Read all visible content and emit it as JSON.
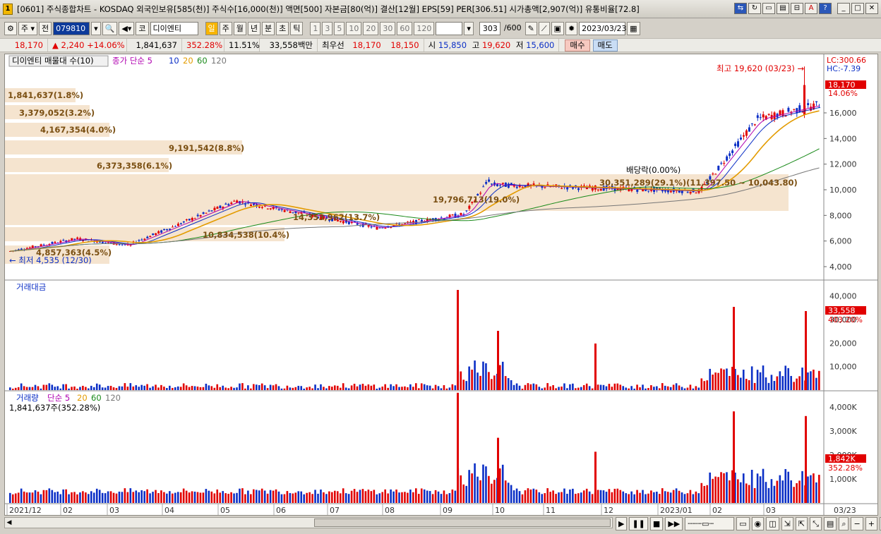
{
  "window": {
    "icon": "chart-app-icon",
    "title": "[0601] 주식종합차트 - KOSDAQ 외국인보유[585(천)] 주식수[16,000(천)] 액면[500] 자본금[80(억)] 결산[12월] EPS[59] PER[306.51] 시가총액[2,907(억)] 유통비율[72.8]"
  },
  "toolbar": {
    "period_select": "주",
    "prev_label": "전",
    "code": "079810",
    "market": "코",
    "stock_name": "디이엔티",
    "period_buttons": [
      "일",
      "주",
      "월",
      "년",
      "분",
      "초",
      "틱"
    ],
    "active_period": "일",
    "interval_buttons": [
      "1",
      "3",
      "5",
      "10",
      "20",
      "30",
      "60",
      "120"
    ],
    "count": "303",
    "count_total": "/600",
    "date": "2023/03/23"
  },
  "quote": {
    "price": "18,170",
    "change": "2,240",
    "change_pct": "+14.06%",
    "volume": "1,841,637",
    "vol_ratio": "352.28%",
    "turnover": "11.51%",
    "amount": "33,558백만",
    "best_label": "최우선",
    "ask": "18,170",
    "bid": "18,150",
    "open_label": "시",
    "open": "15,850",
    "high_label": "고",
    "high": "19,620",
    "low_label": "저",
    "low": "15,600",
    "buy_label": "매수",
    "sell_label": "매도"
  },
  "price_panel": {
    "legend_box": "디이엔티 매물대 수(10)",
    "ma_title": "종가 단순 5",
    "ma_periods": [
      "10",
      "20",
      "60",
      "120"
    ],
    "lc": "LC:300.66",
    "hc": "HC:-7.39",
    "current_tag": "18,170",
    "current_pct": "14.06%",
    "high_note": "최고 19,620 (03/23)",
    "low_note": "최저 4,535 (12/30)",
    "dividend_note": "배당락(0.00%)",
    "y_ticks": [
      "16,000",
      "14,000",
      "12,000",
      "10,000",
      "8,000",
      "6,000",
      "4,000"
    ],
    "volume_profile_labels": [
      "1,841,637(1.8%)",
      "3,379,052(3.2%)",
      "4,167,354(4.0%)",
      "9,191,542(8.8%)",
      "6,373,358(6.1%)",
      "30,351,289(29.1%)(11,397.50 ~ 10,043.80)",
      "19,796,713(19.0%)",
      "14,353,962(13.7%)",
      "10,834,538(10.4%)",
      "4,857,363(4.5%)"
    ]
  },
  "amount_panel": {
    "title": "거래대금",
    "current_tag": "33,558",
    "current_pct": "403.20%",
    "y_ticks": [
      "40,000",
      "30,000",
      "20,000",
      "10,000"
    ]
  },
  "volume_panel": {
    "title": "거래량",
    "ma_title": "단순 5",
    "ma_periods": [
      "20",
      "60",
      "120"
    ],
    "info": "1,841,637주(352.28%)",
    "current_tag": "1,842K",
    "current_pct": "352.28%",
    "y_ticks": [
      "4,000K",
      "3,000K",
      "2,000K",
      "1,000K"
    ]
  },
  "x_axis": {
    "labels": [
      "2021/12",
      "02",
      "03",
      "04",
      "05",
      "06",
      "07",
      "08",
      "09",
      "10",
      "11",
      "12",
      "2023/01",
      "02",
      "03"
    ],
    "right_label": "03/23"
  },
  "colors": {
    "up": "#e10000",
    "down": "#0b2fc6",
    "ma5": "#b000b0",
    "ma10": "#0b2fc6",
    "ma20": "#e39b00",
    "ma60": "#1a8a1a",
    "ma120": "#777777",
    "profile": "#f5e4cf"
  }
}
